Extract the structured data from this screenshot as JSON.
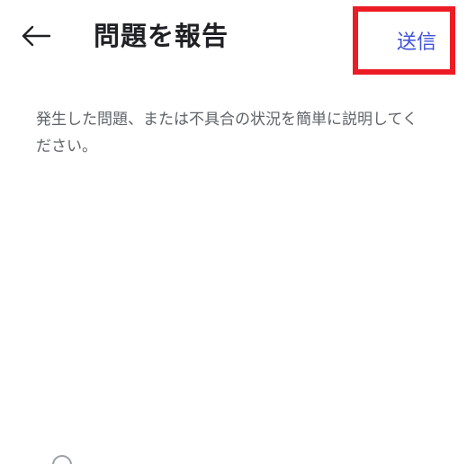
{
  "header": {
    "back_icon": "arrow-left-icon",
    "title": "問題を報告",
    "send_label": "送信"
  },
  "colors": {
    "accent": "#3f51d8",
    "highlight": "#ec1c24",
    "title": "#202124",
    "body_text": "#5f6368"
  },
  "form": {
    "description_placeholder": "発生した問題、または不具合の状況を簡単に説明してください。"
  },
  "footer": {
    "partial_icon": "circle-icon"
  }
}
